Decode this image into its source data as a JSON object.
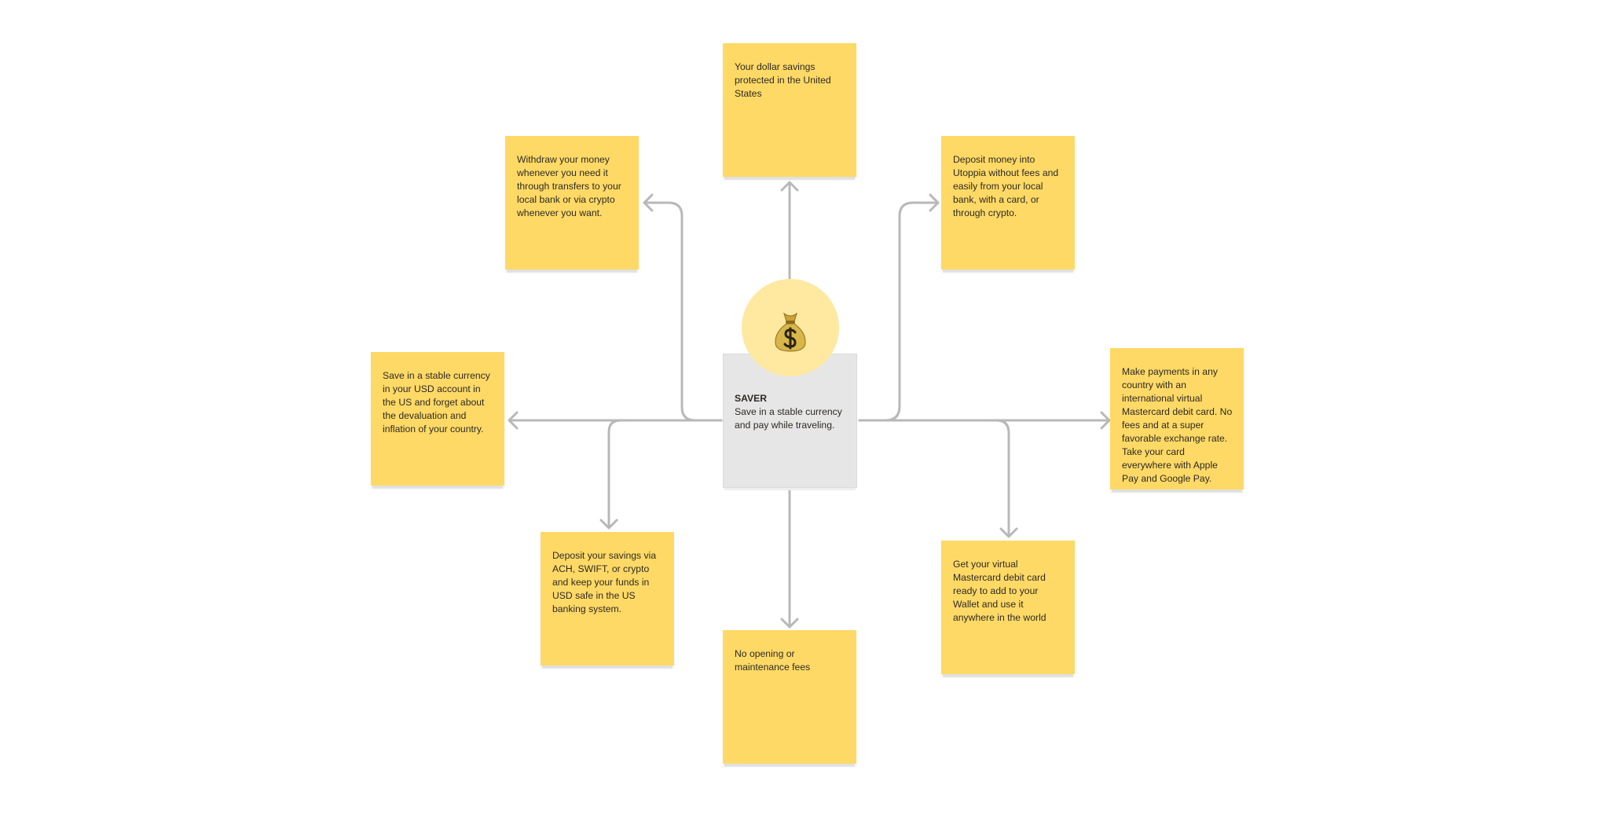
{
  "colors": {
    "sticky": "#ffd966",
    "central_card": "#e6e6e6",
    "badge": "#ffe8a0",
    "connector": "#b8b8b8",
    "text": "#2c2a24"
  },
  "central": {
    "icon": "money-bag-emoji",
    "title": "SAVER",
    "description": "Save in a stable currency and pay while traveling."
  },
  "stickies": [
    {
      "id": "top",
      "text": "Your dollar savings protected in the United States"
    },
    {
      "id": "top-left",
      "text": "Withdraw your money whenever you need it through transfers to your local bank or via crypto whenever you want."
    },
    {
      "id": "top-right",
      "text": "Deposit money into Utoppia without fees and easily from your local bank, with a card, or through crypto."
    },
    {
      "id": "left",
      "text": "Save in a stable currency in your USD account in the US and forget about the devaluation and inflation of your country."
    },
    {
      "id": "right",
      "text": "Make payments in any country with an international virtual Mastercard debit card. No fees and at a super favorable exchange rate. Take your card everywhere with Apple Pay and Google Pay."
    },
    {
      "id": "bottom-left",
      "text": "Deposit your savings via ACH, SWIFT, or crypto and keep your funds in USD safe in the US banking system."
    },
    {
      "id": "bottom-right",
      "text": "Get your virtual Mastercard debit card ready to add to your Wallet and use it anywhere in the world"
    },
    {
      "id": "bottom",
      "text": "No opening or maintenance fees"
    }
  ],
  "connectors": [
    {
      "from": "central",
      "to": "top"
    },
    {
      "from": "central",
      "to": "top-left"
    },
    {
      "from": "central",
      "to": "top-right"
    },
    {
      "from": "central",
      "to": "left"
    },
    {
      "from": "central",
      "to": "right"
    },
    {
      "from": "central",
      "to": "bottom-left"
    },
    {
      "from": "central",
      "to": "bottom-right"
    },
    {
      "from": "central",
      "to": "bottom"
    }
  ]
}
